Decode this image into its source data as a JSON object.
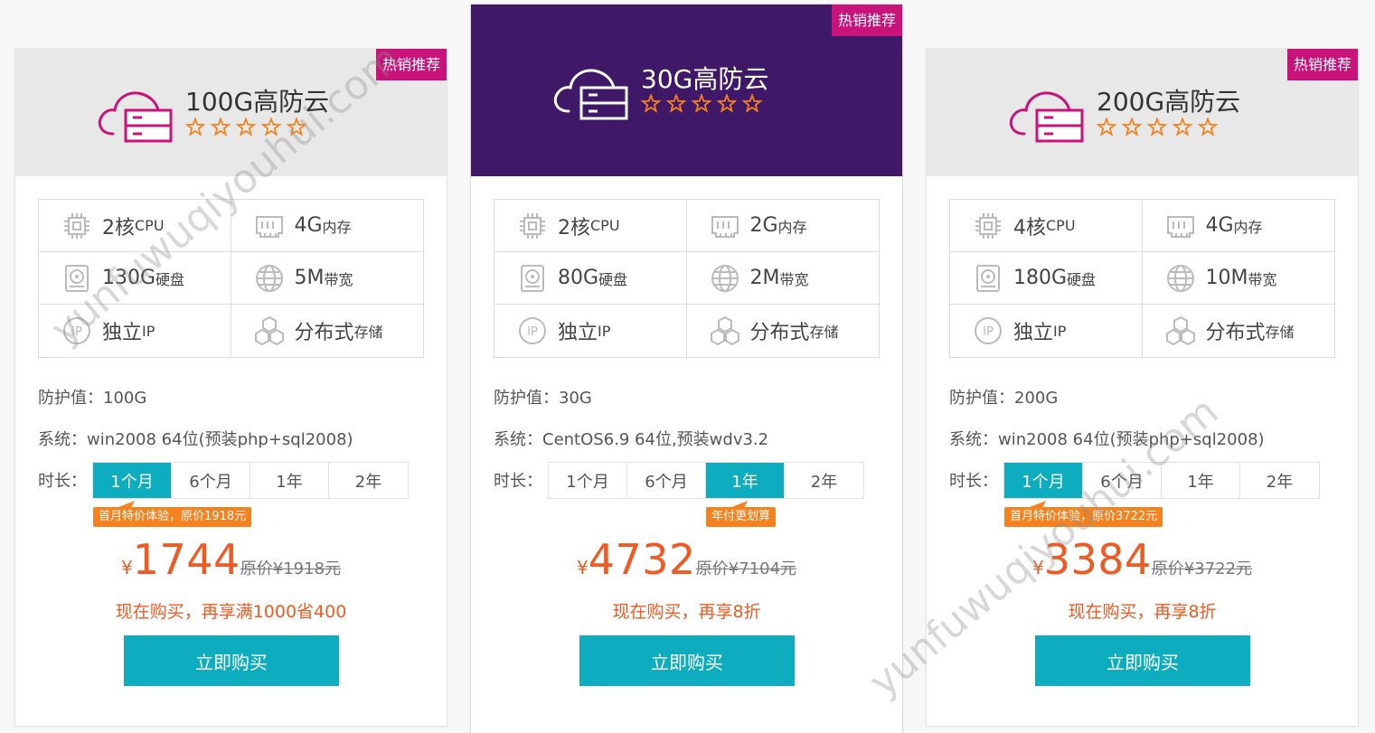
{
  "colors": {
    "accent": "#0eacbf",
    "badge": "#c8137a",
    "featured_header": "#3f1867",
    "price": "#f05a22",
    "tip": "#f6821f"
  },
  "cards": [
    {
      "badge": "热销推荐",
      "title": "100G高防云",
      "rating": 5,
      "specs": [
        {
          "icon": "cpu-icon",
          "value": "2核",
          "unit": "CPU"
        },
        {
          "icon": "memory-icon",
          "value": "4G",
          "unit": "内存"
        },
        {
          "icon": "disk-icon",
          "value": "130G",
          "unit": "硬盘"
        },
        {
          "icon": "globe-icon",
          "value": "5M",
          "unit": "带宽"
        },
        {
          "icon": "ip-icon",
          "value": "独立",
          "unit": "IP"
        },
        {
          "icon": "storage-icon",
          "value": "分布式",
          "unit": "存储"
        }
      ],
      "protection": "防护值：100G",
      "system": "系统：win2008 64位(预装php+sql2008)",
      "duration_label": "时长：",
      "durations": [
        "1个月",
        "6个月",
        "1年",
        "2年"
      ],
      "selected_duration": 0,
      "tip": "首月特价体验，原价1918元",
      "currency": "¥",
      "price": "1744",
      "original_price": "原价¥1918元",
      "promo": "现在购买，再享满1000省400",
      "buy_label": "立即购买"
    },
    {
      "badge": "热销推荐",
      "title": "30G高防云",
      "rating": 5,
      "specs": [
        {
          "icon": "cpu-icon",
          "value": "2核",
          "unit": "CPU"
        },
        {
          "icon": "memory-icon",
          "value": "2G",
          "unit": "内存"
        },
        {
          "icon": "disk-icon",
          "value": "80G",
          "unit": "硬盘"
        },
        {
          "icon": "globe-icon",
          "value": "2M",
          "unit": "带宽"
        },
        {
          "icon": "ip-icon",
          "value": "独立",
          "unit": "IP"
        },
        {
          "icon": "storage-icon",
          "value": "分布式",
          "unit": "存储"
        }
      ],
      "protection": "防护值：30G",
      "system": "系统：CentOS6.9 64位,预装wdv3.2",
      "duration_label": "时长：",
      "durations": [
        "1个月",
        "6个月",
        "1年",
        "2年"
      ],
      "selected_duration": 2,
      "tip": "年付更划算",
      "currency": "¥",
      "price": "4732",
      "original_price": "原价¥7104元",
      "promo": "现在购买，再享8折",
      "buy_label": "立即购买"
    },
    {
      "badge": "热销推荐",
      "title": "200G高防云",
      "rating": 5,
      "specs": [
        {
          "icon": "cpu-icon",
          "value": "4核",
          "unit": "CPU"
        },
        {
          "icon": "memory-icon",
          "value": "4G",
          "unit": "内存"
        },
        {
          "icon": "disk-icon",
          "value": "180G",
          "unit": "硬盘"
        },
        {
          "icon": "globe-icon",
          "value": "10M",
          "unit": "带宽"
        },
        {
          "icon": "ip-icon",
          "value": "独立",
          "unit": "IP"
        },
        {
          "icon": "storage-icon",
          "value": "分布式",
          "unit": "存储"
        }
      ],
      "protection": "防护值：200G",
      "system": "系统：win2008 64位(预装php+sql2008)",
      "duration_label": "时长：",
      "durations": [
        "1个月",
        "6个月",
        "1年",
        "2年"
      ],
      "selected_duration": 0,
      "tip": "首月特价体验，原价3722元",
      "currency": "¥",
      "price": "3384",
      "original_price": "原价¥3722元",
      "promo": "现在购买，再享8折",
      "buy_label": "立即购买"
    }
  ],
  "watermark": "yunfuwuqiyouhui.com"
}
